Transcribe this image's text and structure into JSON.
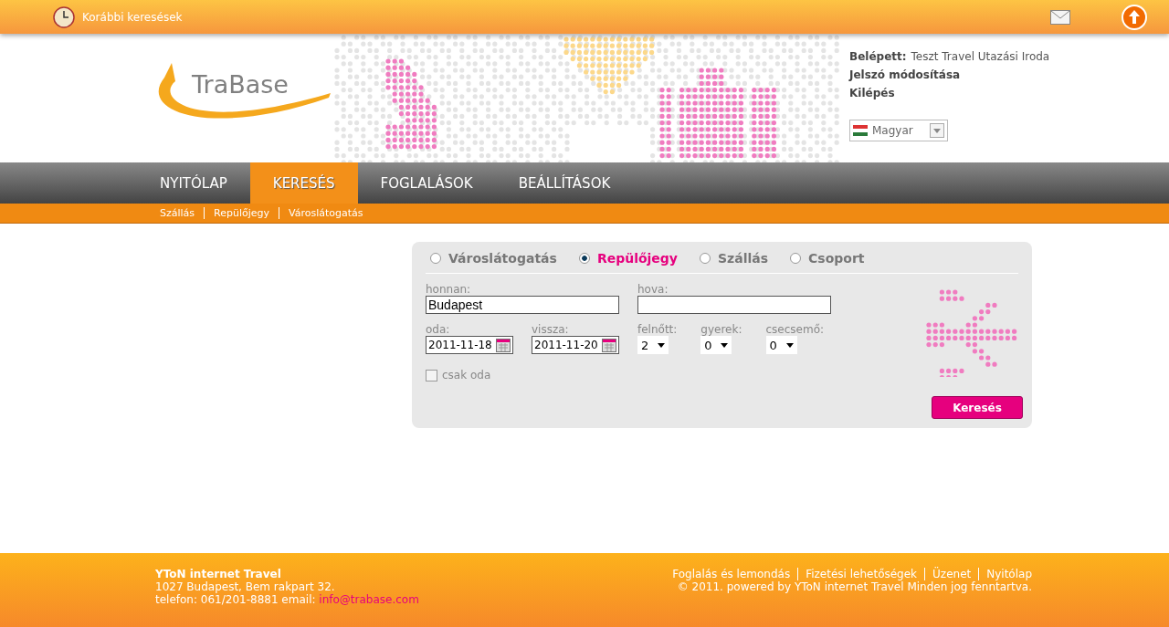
{
  "top_bar": {
    "history_link": "Korábbi keresések"
  },
  "logo": {
    "text": "TraBase"
  },
  "user": {
    "logged_in_label": "Belépett:",
    "logged_in_name": "Teszt Travel Utazási Iroda",
    "links": [
      "Jelszó módosítása",
      "Kilépés"
    ],
    "language": "Magyar"
  },
  "nav": {
    "tabs": [
      {
        "label": "NYITÓLAP",
        "selected": false
      },
      {
        "label": "KERESÉS",
        "selected": true
      },
      {
        "label": "FOGLALÁSOK",
        "selected": false
      },
      {
        "label": "BEÁLLÍTÁSOK",
        "selected": false
      }
    ],
    "sub_items": [
      "Szállás",
      "Repülőjegy",
      "Városlátogatás"
    ]
  },
  "search": {
    "types": [
      {
        "label": "Városlátogatás",
        "selected": false
      },
      {
        "label": "Repülőjegy",
        "selected": true
      },
      {
        "label": "Szállás",
        "selected": false
      },
      {
        "label": "Csoport",
        "selected": false
      }
    ],
    "from": {
      "label": "honnan:",
      "value": "Budapest"
    },
    "to": {
      "label": "hova:"
    },
    "depart": {
      "label": "oda:",
      "value": "2011-11-18"
    },
    "return": {
      "label": "vissza:",
      "value": "2011-11-20"
    },
    "passengers": [
      {
        "label": "felnőtt:",
        "value": "2"
      },
      {
        "label": "gyerek:",
        "value": "0"
      },
      {
        "label": "csecsemő:",
        "value": "0"
      }
    ],
    "one_way": {
      "label": "csak oda",
      "checked": false
    },
    "submit": "Keresés"
  },
  "footer": {
    "company": "YToN internet Travel",
    "address": "1027 Budapest, Bem rakpart 32.",
    "contact": "telefon: 061/201-8881 email: ",
    "email": "info@trabase.com",
    "links": [
      "Foglalás és lemondás",
      "Fizetési lehetőségek",
      "Üzenet",
      "Nyitólap"
    ],
    "copyright": "© 2011. powered by YToN internet Travel Minden jog fenntartva."
  }
}
